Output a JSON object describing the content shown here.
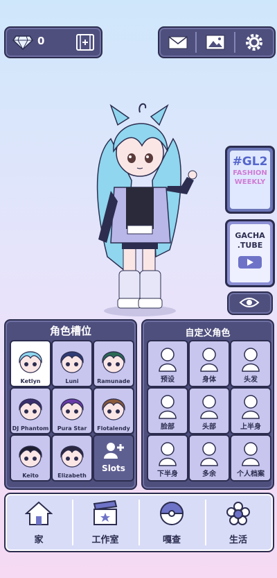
{
  "top": {
    "gem_count": "0"
  },
  "side": {
    "gl2_title": "#GL2",
    "gl2_line1": "FASHION",
    "gl2_line2": "WEEKLY",
    "tube_line1": "GACHA",
    "tube_line2": ".TUBE"
  },
  "slots": {
    "title": "角色槽位",
    "items": [
      {
        "name": "Ketlyn",
        "hair": "#8fd6ee"
      },
      {
        "name": "Luni",
        "hair": "#2f3b74"
      },
      {
        "name": "Ramunade",
        "hair": "#2a6a55"
      },
      {
        "name": "DJ Phantom",
        "hair": "#3b2f6e"
      },
      {
        "name": "Pura Star",
        "hair": "#6a3aa8"
      },
      {
        "name": "Flotalendy",
        "hair": "#8a5a3a"
      },
      {
        "name": "Keito",
        "hair": "#1e1e2e"
      },
      {
        "name": "Elizabeth",
        "hair": "#2b2740"
      }
    ],
    "add_label": "Slots"
  },
  "custom": {
    "title": "自定义角色",
    "items": [
      {
        "label": "预设"
      },
      {
        "label": "身体"
      },
      {
        "label": "头发"
      },
      {
        "label": "脸部"
      },
      {
        "label": "头部"
      },
      {
        "label": "上半身"
      },
      {
        "label": "下半身"
      },
      {
        "label": "多余"
      },
      {
        "label": "个人档案"
      }
    ]
  },
  "nav": {
    "items": [
      {
        "label": "家"
      },
      {
        "label": "工作室"
      },
      {
        "label": "嘎查"
      },
      {
        "label": "生活"
      }
    ]
  },
  "colors": {
    "panel": "#4e4f7d",
    "panel_border": "#2c2d4f",
    "tile": "#c8c6ee",
    "accent_hair": "#8fd6ee"
  }
}
